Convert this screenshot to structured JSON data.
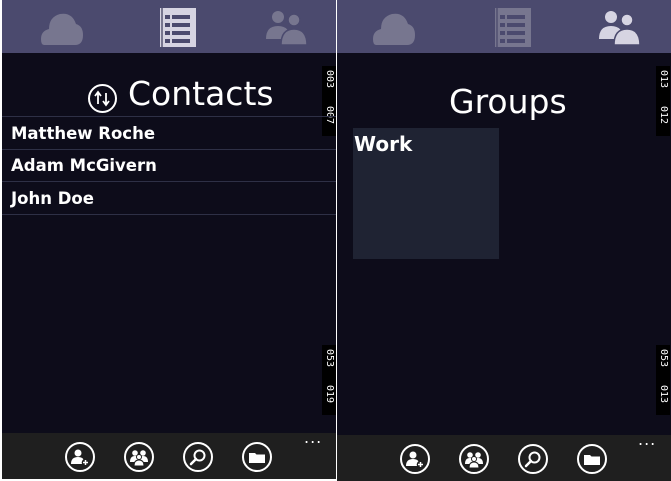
{
  "contacts_screen": {
    "title": "Contacts",
    "contacts": [
      {
        "name": "Matthew Roche"
      },
      {
        "name": "Adam McGivern"
      },
      {
        "name": "John Doe"
      }
    ],
    "counters_top": [
      "003",
      "007"
    ],
    "counters_bottom": [
      "053",
      "019"
    ],
    "more": "..."
  },
  "groups_screen": {
    "title": "Groups",
    "groups": [
      {
        "name": "Work"
      }
    ],
    "counters_top": [
      "013",
      "012"
    ],
    "counters_bottom": [
      "053",
      "013"
    ],
    "more": "..."
  },
  "pivot_tabs": [
    {
      "icon": "cloud-icon",
      "active": false
    },
    {
      "icon": "list-icon",
      "active": true
    },
    {
      "icon": "people-icon",
      "active": false
    }
  ],
  "app_bar_buttons": [
    {
      "icon": "add-contact-icon"
    },
    {
      "icon": "group-icon"
    },
    {
      "icon": "search-icon"
    },
    {
      "icon": "folder-icon"
    }
  ],
  "colors": {
    "top_bar": "#4b4a6e",
    "background": "#0d0c1a",
    "app_bar": "#1f1f1f",
    "tile": "#1f2333",
    "inactive_icon": "#77768f",
    "active_icon": "#d6d4e2"
  }
}
